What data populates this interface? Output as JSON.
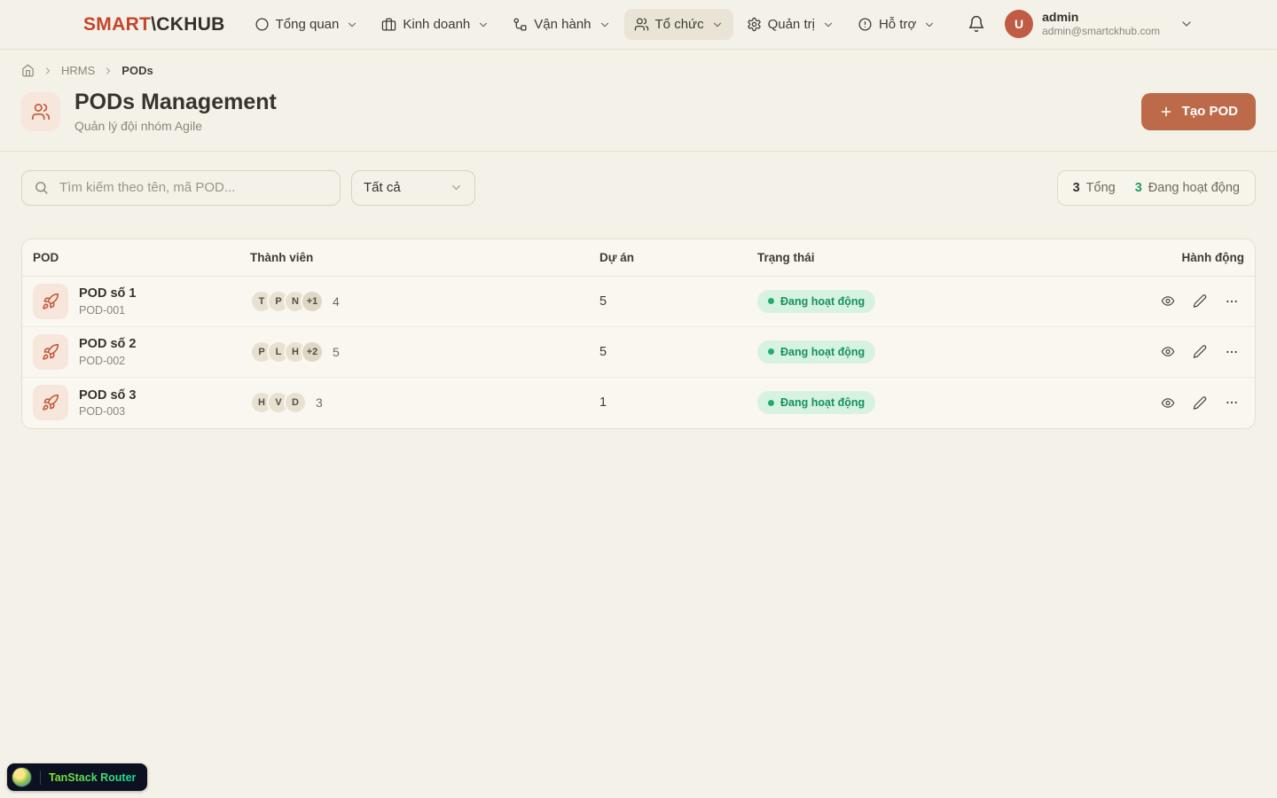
{
  "nav": {
    "logo": {
      "part1": "SMART",
      "part2": "\\CKHUB"
    },
    "items": [
      {
        "key": "overview",
        "label": "Tổng quan",
        "icon": "circle",
        "active": false
      },
      {
        "key": "business",
        "label": "Kinh doanh",
        "icon": "briefcase",
        "active": false
      },
      {
        "key": "operations",
        "label": "Vận hành",
        "icon": "workflow",
        "active": false
      },
      {
        "key": "organization",
        "label": "Tổ chức",
        "icon": "users",
        "active": true
      },
      {
        "key": "admin",
        "label": "Quản trị",
        "icon": "settings",
        "active": false
      },
      {
        "key": "support",
        "label": "Hỗ trợ",
        "icon": "alert-circle",
        "active": false
      }
    ],
    "user": {
      "initial": "U",
      "name": "admin",
      "email": "admin@smartckhub.com"
    }
  },
  "breadcrumb": {
    "items": [
      "HRMS",
      "PODs"
    ]
  },
  "header": {
    "title": "PODs Management",
    "subtitle": "Quản lý đội nhóm Agile",
    "create_button": "Tạo POD"
  },
  "toolbar": {
    "search_placeholder": "Tìm kiếm theo tên, mã POD...",
    "filter_value": "Tất cả",
    "stats": [
      {
        "value": "3",
        "label": "Tổng",
        "value_color": "#33302a"
      },
      {
        "value": "3",
        "label": "Đang hoạt động",
        "value_color": "#1f9d63"
      }
    ]
  },
  "table": {
    "headers": [
      "POD",
      "Thành viên",
      "Dự án",
      "Trạng thái",
      "Hành động"
    ],
    "rows": [
      {
        "name": "POD số 1",
        "code": "POD-001",
        "avatars": [
          "T",
          "P",
          "N",
          "+1"
        ],
        "member_count": "4",
        "projects": "5",
        "status": "Đang hoạt động"
      },
      {
        "name": "POD số 2",
        "code": "POD-002",
        "avatars": [
          "P",
          "L",
          "H",
          "+2"
        ],
        "member_count": "5",
        "projects": "5",
        "status": "Đang hoạt động"
      },
      {
        "name": "POD số 3",
        "code": "POD-003",
        "avatars": [
          "H",
          "V",
          "D"
        ],
        "member_count": "3",
        "projects": "1",
        "status": "Đang hoạt động"
      }
    ]
  },
  "devtools": {
    "label": "TanStack Router"
  },
  "colors": {
    "accent": "#bd6a4a",
    "logo_red": "#c2452c",
    "status_text": "#15925e",
    "status_bg": "#d7f2e1",
    "page_bg": "#f4f1e9",
    "card_bg": "#f9f7f0"
  }
}
